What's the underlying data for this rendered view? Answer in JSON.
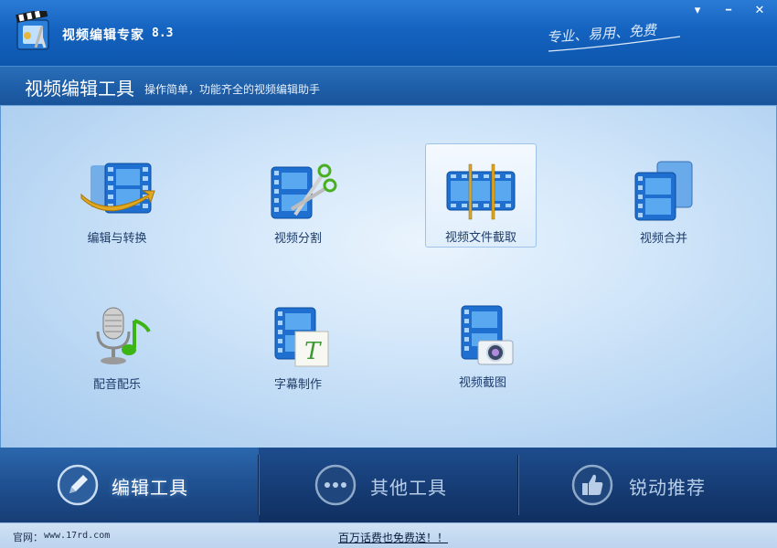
{
  "window": {
    "title": "视频编辑专家",
    "version": "8.3",
    "slogan": "专业、易用、免费",
    "controls": {
      "menu": "▾",
      "minimize": "━",
      "close": "✕"
    }
  },
  "header": {
    "title": "视频编辑工具",
    "subtitle": "操作简单，功能齐全的视频编辑助手"
  },
  "tools": [
    {
      "label": "编辑与转换",
      "icon": "film-convert-icon"
    },
    {
      "label": "视频分割",
      "icon": "film-scissors-icon"
    },
    {
      "label": "视频文件截取",
      "icon": "film-clip-icon",
      "selected": true
    },
    {
      "label": "视频合并",
      "icon": "film-merge-icon"
    },
    {
      "label": "配音配乐",
      "icon": "microphone-music-icon"
    },
    {
      "label": "字幕制作",
      "icon": "film-subtitle-icon"
    },
    {
      "label": "视频截图",
      "icon": "film-camera-icon"
    }
  ],
  "tabs": [
    {
      "label": "编辑工具",
      "icon": "pencil-icon",
      "active": true
    },
    {
      "label": "其他工具",
      "icon": "more-dots-icon",
      "active": false
    },
    {
      "label": "锐动推荐",
      "icon": "thumbs-up-icon",
      "active": false
    }
  ],
  "status": {
    "site_label": "官网：",
    "site_url": "www.17rd.com",
    "promo": "百万话费也免费送！！"
  },
  "colors": {
    "titlebar": "#1463c0",
    "content_bg": "#d3e7fa",
    "tabbar": "#163c74",
    "accent_gold": "#e0a820",
    "film_blue": "#1f6fd1"
  }
}
